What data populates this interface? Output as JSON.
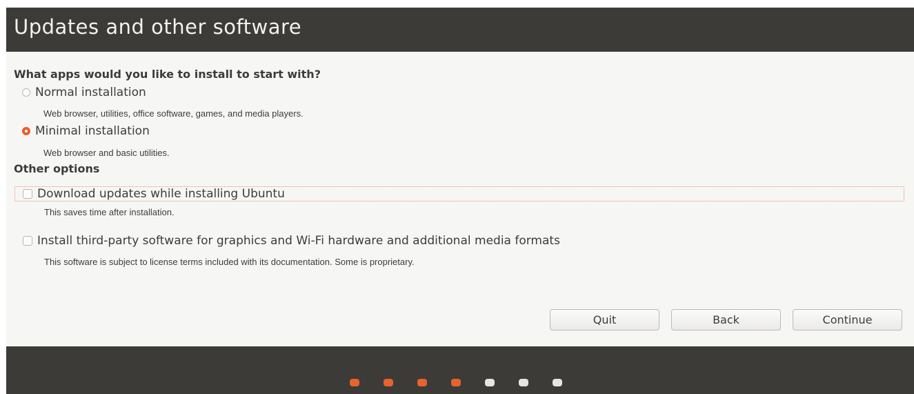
{
  "header": {
    "title": "Updates and other software"
  },
  "apps_section": {
    "heading": "What apps would you like to install to start with?",
    "options": [
      {
        "label": "Normal installation",
        "description": "Web browser, utilities, office software, games, and media players.",
        "selected": false
      },
      {
        "label": "Minimal installation",
        "description": "Web browser and basic utilities.",
        "selected": true
      }
    ]
  },
  "other_section": {
    "heading": "Other options",
    "options": [
      {
        "label": "Download updates while installing Ubuntu",
        "description": "This saves time after installation.",
        "checked": false,
        "focused": true
      },
      {
        "label": "Install third-party software for graphics and Wi-Fi hardware and additional media formats",
        "description": "This software is subject to license terms included with its documentation. Some is proprietary.",
        "checked": false,
        "focused": false
      }
    ]
  },
  "buttons": {
    "quit": "Quit",
    "back": "Back",
    "continue": "Continue"
  },
  "progress": {
    "total_steps": 7,
    "completed_steps": 4,
    "active_color": "#e8622e",
    "inactive_color": "#e6e5e3"
  },
  "colors": {
    "header_bg": "#3c3b37",
    "accent": "#ea5d2b",
    "page_bg": "#f6f6f5"
  }
}
